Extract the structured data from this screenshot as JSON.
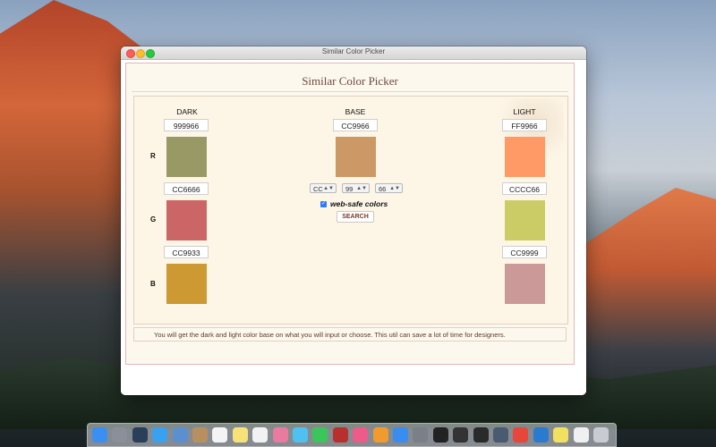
{
  "window": {
    "title": "Similar Color Picker"
  },
  "app": {
    "heading": "Similar Color Picker",
    "columns": {
      "dark": "DARK",
      "base": "BASE",
      "light": "LIGHT"
    },
    "row_labels": {
      "r": "R",
      "g": "G",
      "b": "B"
    },
    "dark": [
      {
        "hex": "999966",
        "color": "#999966"
      },
      {
        "hex": "CC6666",
        "color": "#CC6666"
      },
      {
        "hex": "CC9933",
        "color": "#CC9933"
      }
    ],
    "light": [
      {
        "hex": "FF9966",
        "color": "#FF9966"
      },
      {
        "hex": "CCCC66",
        "color": "#CCCC66"
      },
      {
        "hex": "CC9999",
        "color": "#CC9999"
      }
    ],
    "base": {
      "hex": "CC9966",
      "color": "#CC9966",
      "r_select": "CC",
      "g_select": "99",
      "b_select": "66",
      "websafe_label": "web-safe colors",
      "websafe_checked": true,
      "search_label": "SEARCH"
    },
    "info_text": "You will get the dark and light color base on what you will input or choose. This util can save a lot of time for designers."
  },
  "dock": {
    "icons": [
      {
        "name": "finder-icon",
        "color": "#3b8ff0"
      },
      {
        "name": "launchpad-icon",
        "color": "#8a8f99"
      },
      {
        "name": "mission-control-icon",
        "color": "#2a3f5a"
      },
      {
        "name": "safari-icon",
        "color": "#3aa0f0"
      },
      {
        "name": "preview-icon",
        "color": "#5b8fd0"
      },
      {
        "name": "notes-folder-icon",
        "color": "#b89060"
      },
      {
        "name": "calendar-icon",
        "color": "#f4f4f4"
      },
      {
        "name": "notes-icon",
        "color": "#f7e27a"
      },
      {
        "name": "reminders-icon",
        "color": "#f2f2f2"
      },
      {
        "name": "photos-icon",
        "color": "#e97aa0"
      },
      {
        "name": "messages-icon",
        "color": "#4fc1f0"
      },
      {
        "name": "facetime-icon",
        "color": "#3cc55a"
      },
      {
        "name": "photo-booth-icon",
        "color": "#b8302e"
      },
      {
        "name": "itunes-icon",
        "color": "#ee5a8a"
      },
      {
        "name": "ibooks-icon",
        "color": "#f09a30"
      },
      {
        "name": "app-store-icon",
        "color": "#3a8df0"
      },
      {
        "name": "system-preferences-icon",
        "color": "#7a7f88"
      },
      {
        "name": "terminal-icon",
        "color": "#222222"
      },
      {
        "name": "activity-monitor-icon",
        "color": "#333333"
      },
      {
        "name": "console-icon",
        "color": "#2a2a2a"
      },
      {
        "name": "network-utility-icon",
        "color": "#4a5a70"
      },
      {
        "name": "chrome-icon",
        "color": "#e8463a"
      },
      {
        "name": "vscode-icon",
        "color": "#2a7ad0"
      },
      {
        "name": "color-picker-icon",
        "color": "#f2e060"
      },
      {
        "name": "document-icon",
        "color": "#f0f0f0"
      },
      {
        "name": "trash-icon",
        "color": "#c8ccd2"
      }
    ]
  }
}
